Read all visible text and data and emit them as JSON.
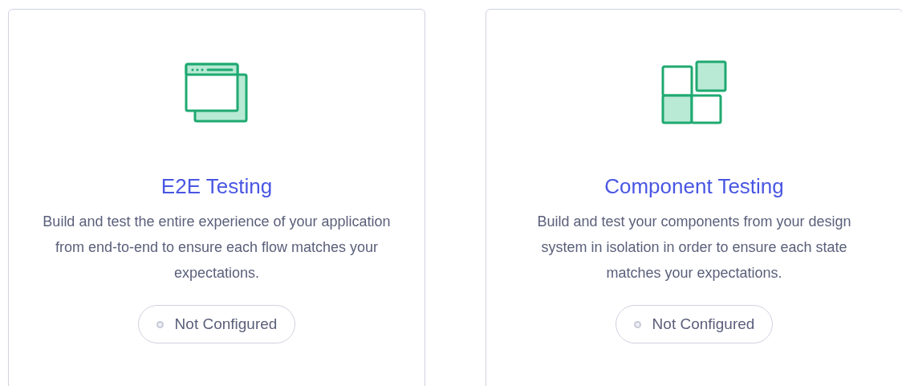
{
  "cards": [
    {
      "kind": "browser",
      "title": "E2E Testing",
      "description": "Build and test the entire experience of your application from end-to-end to ensure each flow matches your expectations.",
      "status": {
        "label": "Not Configured",
        "configured": false
      }
    },
    {
      "kind": "components",
      "title": "Component Testing",
      "description": "Build and test your components from your design system in isolation in order to ensure each state matches your expectations.",
      "status": {
        "label": "Not Configured",
        "configured": false
      }
    }
  ]
}
